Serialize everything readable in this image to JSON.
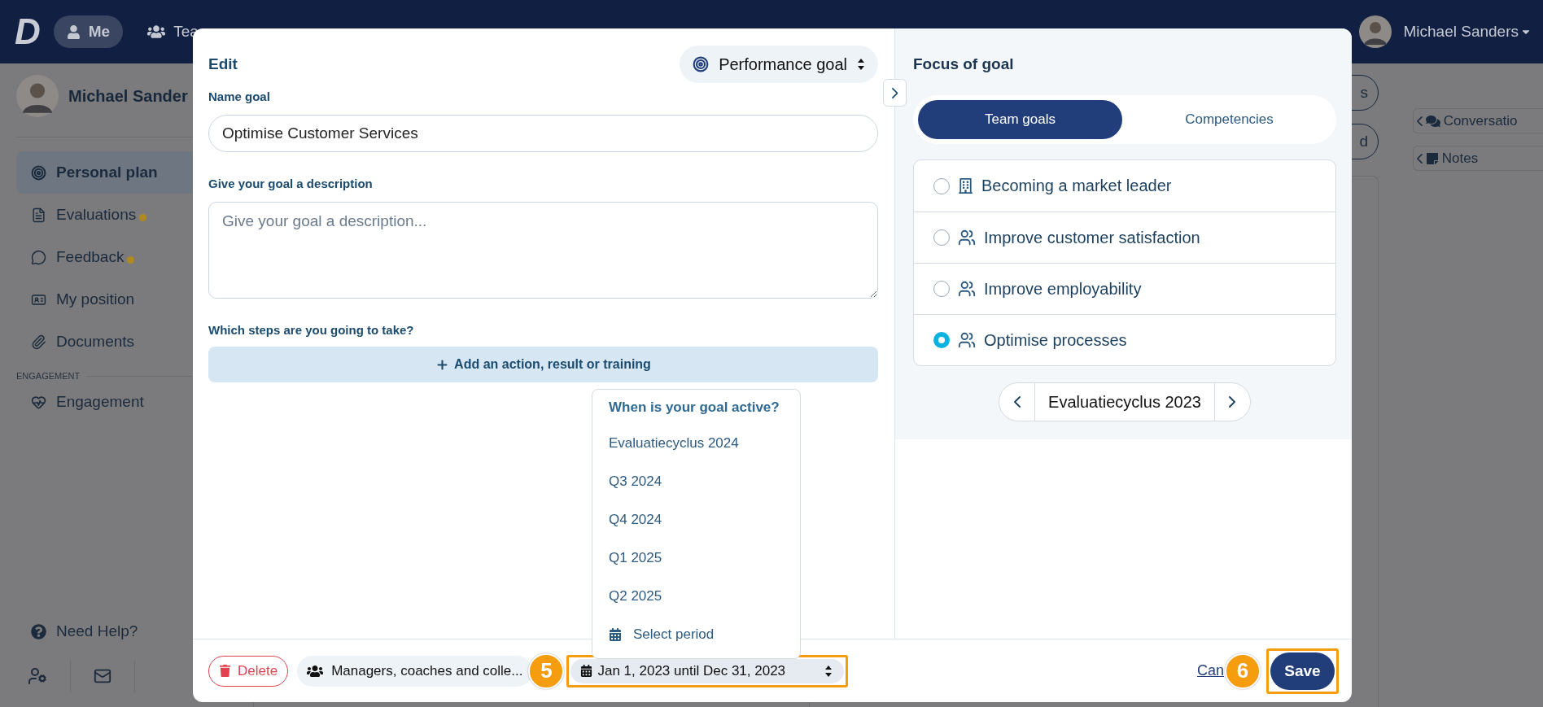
{
  "topbar": {
    "logo": "D",
    "nav": [
      {
        "label": "Me",
        "selected": true
      },
      {
        "label": "Tea",
        "selected": false
      }
    ],
    "user": "Michael Sanders"
  },
  "sidebar": {
    "profile_name": "Michael Sander",
    "items": [
      {
        "label": "Personal plan",
        "selected": true,
        "dot": false
      },
      {
        "label": "Evaluations",
        "selected": false,
        "dot": true
      },
      {
        "label": "Feedback",
        "selected": false,
        "dot": true
      },
      {
        "label": "My position",
        "selected": false,
        "dot": false
      },
      {
        "label": "Documents",
        "selected": false,
        "dot": false
      }
    ],
    "section": "ENGAGEMENT",
    "section_items": [
      {
        "label": "Engagement",
        "selected": false,
        "dot": false
      }
    ],
    "help": "Need Help?"
  },
  "main": {
    "buttons": [
      "s",
      "d"
    ]
  },
  "right_rail": {
    "panels": [
      "Conversatio",
      "Notes"
    ]
  },
  "modal": {
    "title": "Edit",
    "goal_type": "Performance goal",
    "name_label": "Name goal",
    "name_value": "Optimise Customer Services",
    "description_label": "Give your goal a description",
    "description_placeholder": "Give your goal a description...",
    "steps_label": "Which steps are you going to take?",
    "add_step": "Add an action, result or training",
    "period_menu": {
      "title": "When is your goal active?",
      "options": [
        "Evaluatiecyclus 2024",
        "Q3 2024",
        "Q4 2024",
        "Q1 2025",
        "Q2 2025"
      ],
      "custom": "Select period"
    },
    "focus": {
      "title": "Focus of goal",
      "tabs": [
        {
          "label": "Team goals",
          "selected": true
        },
        {
          "label": "Competencies",
          "selected": false
        }
      ],
      "goals": [
        {
          "label": "Becoming a market leader",
          "kind": "organisation",
          "selected": false
        },
        {
          "label": "Improve customer satisfaction",
          "kind": "team",
          "selected": false
        },
        {
          "label": "Improve employability",
          "kind": "team",
          "selected": false
        },
        {
          "label": "Optimise processes",
          "kind": "team",
          "selected": true
        }
      ],
      "cycle": "Evaluatiecyclus 2023"
    },
    "footer": {
      "delete": "Delete",
      "visibility": "Managers, coaches and colle...",
      "period": {
        "label": "Jan 1, 2023 until Dec 31, 2023",
        "highlighted": true,
        "callout": "5"
      },
      "cancel": "Can",
      "save": {
        "label": "Save",
        "highlighted": true,
        "callout": "6"
      }
    }
  }
}
